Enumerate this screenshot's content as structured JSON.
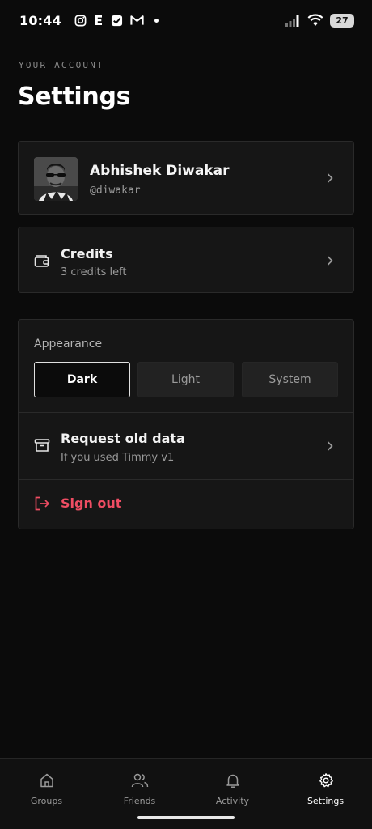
{
  "status_bar": {
    "time": "10:44",
    "battery": "27",
    "icons": [
      "instagram-icon",
      "e-app-icon",
      "check-app-icon",
      "gmail-icon",
      "dot-icon",
      "signal-icon",
      "wifi-icon",
      "battery-icon"
    ]
  },
  "header": {
    "eyebrow": "YOUR ACCOUNT",
    "title": "Settings"
  },
  "profile": {
    "name": "Abhishek Diwakar",
    "handle": "@diwakar"
  },
  "credits": {
    "title": "Credits",
    "subtitle": "3 credits left"
  },
  "appearance": {
    "label": "Appearance",
    "options": [
      "Dark",
      "Light",
      "System"
    ],
    "selected": "Dark"
  },
  "request_data": {
    "title": "Request old data",
    "subtitle": "If you used Timmy v1"
  },
  "sign_out": {
    "label": "Sign out",
    "color": "#ef4d63"
  },
  "bottom_nav": {
    "items": [
      {
        "label": "Groups",
        "icon": "home-icon"
      },
      {
        "label": "Friends",
        "icon": "friends-icon"
      },
      {
        "label": "Activity",
        "icon": "bell-icon"
      },
      {
        "label": "Settings",
        "icon": "gear-icon"
      }
    ],
    "active": "Settings"
  },
  "colors": {
    "background": "#0b0b0b",
    "card": "#161616",
    "accent_danger": "#ef4d63"
  }
}
